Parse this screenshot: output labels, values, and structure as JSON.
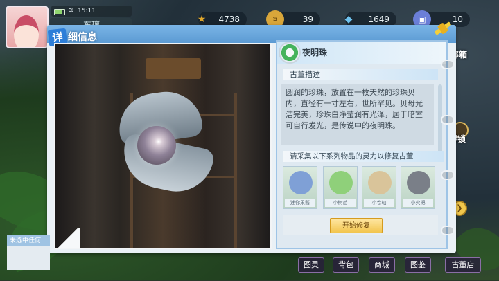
{
  "status_bar": {
    "time": "15:11"
  },
  "player": {
    "name": "东璃"
  },
  "resources": [
    {
      "icon": "star-icon",
      "value": "4738",
      "color": "#e0a72c"
    },
    {
      "icon": "coin-icon",
      "value": "39",
      "color": "#d9a63a"
    },
    {
      "icon": "diamond-icon",
      "value": "1649",
      "color": "#6fc3ef"
    },
    {
      "icon": "ticket-icon",
      "value": "10",
      "color": "#6b7fd8"
    }
  ],
  "panel": {
    "title_tag": "详",
    "title_rest": "细信息"
  },
  "item": {
    "name": "夜明珠",
    "section_description": "古董描述",
    "description": "圆润的珍珠，放置在一枚天然的珍珠贝内，直径有一寸左右，世所罕见。贝母光洁完美，珍珠白净莹润有光泽，居于暗室可自行发光，是传说中的夜明珠。",
    "section_collect": "请采集以下系列物品的灵力以修复古董",
    "materials": [
      {
        "name": "迷你果酱",
        "color": "#7fa0d6"
      },
      {
        "name": "小树苗",
        "color": "#8fd07a"
      },
      {
        "name": "小卷轴",
        "color": "#d9c49a"
      },
      {
        "name": "小火把",
        "color": "#7a7f88"
      }
    ],
    "repair_button": "开始修复"
  },
  "side": {
    "chest_label": "部箱",
    "unlock_label": "解锁"
  },
  "bottom_left": {
    "unselected": "未选中任何"
  },
  "bottom_nav": [
    "图灵",
    "背包",
    "商城",
    "图鉴",
    "古董店"
  ]
}
